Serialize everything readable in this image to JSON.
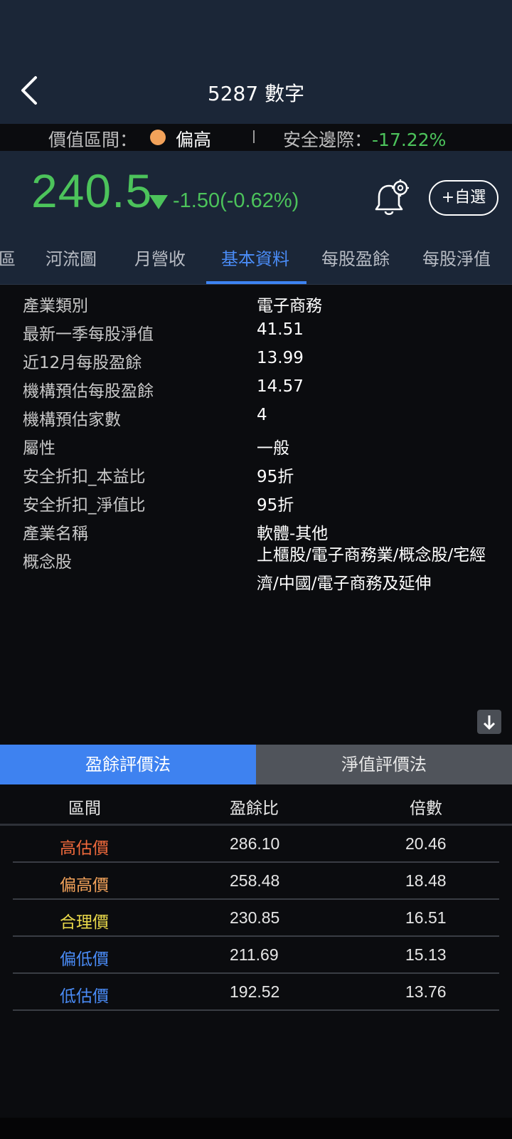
{
  "header": {
    "title": "5287 數字"
  },
  "value_bar": {
    "label": "價值區間：",
    "level": "偏高",
    "level_color": "#f2a25a",
    "margin_label": "安全邊際：",
    "margin_value": "-17.22%"
  },
  "quote": {
    "price": "240.5",
    "change": "-1.50(-0.62%)",
    "watch_label": "+自選"
  },
  "tabs": {
    "partial": "區",
    "items": [
      "河流圖",
      "月營收",
      "基本資料",
      "每股盈餘",
      "每股淨值"
    ],
    "active": "基本資料"
  },
  "basic_info": {
    "rows": [
      {
        "label": "產業類別",
        "value": "電子商務"
      },
      {
        "label": "最新一季每股淨值",
        "value": "41.51"
      },
      {
        "label": "近12月每股盈餘",
        "value": "13.99"
      },
      {
        "label": "機構預估每股盈餘",
        "value": "14.57"
      },
      {
        "label": "機構預估家數",
        "value": "4"
      },
      {
        "label": "屬性",
        "value": "一般"
      },
      {
        "label": "安全折扣_本益比",
        "value": "95折"
      },
      {
        "label": "安全折扣_淨值比",
        "value": "95折"
      },
      {
        "label": "產業名稱",
        "value": "軟體-其他"
      },
      {
        "label": "概念股",
        "value": "上櫃股/電子商務業/概念股/宅經濟/中國/電子商務及延伸"
      }
    ]
  },
  "valuation": {
    "tabs": {
      "eps_method": "盈餘評價法",
      "nav_method": "淨值評價法"
    },
    "columns": {
      "range": "區間",
      "pe": "盈餘比",
      "multiple": "倍數"
    },
    "rows": [
      {
        "level": "高估價",
        "pe": "286.10",
        "multiple": "20.46",
        "color": "#f06a3c"
      },
      {
        "level": "偏高價",
        "pe": "258.48",
        "multiple": "18.48",
        "color": "#f2a25a"
      },
      {
        "level": "合理價",
        "pe": "230.85",
        "multiple": "16.51",
        "color": "#e8d84a"
      },
      {
        "level": "偏低價",
        "pe": "211.69",
        "multiple": "15.13",
        "color": "#4a8cf7"
      },
      {
        "level": "低估價",
        "pe": "192.52",
        "multiple": "13.76",
        "color": "#4a8cf7"
      }
    ]
  },
  "colors": {
    "up_down_green": "#4cc35b",
    "accent_blue": "#3e82f0",
    "header_bg": "#1b2637"
  }
}
